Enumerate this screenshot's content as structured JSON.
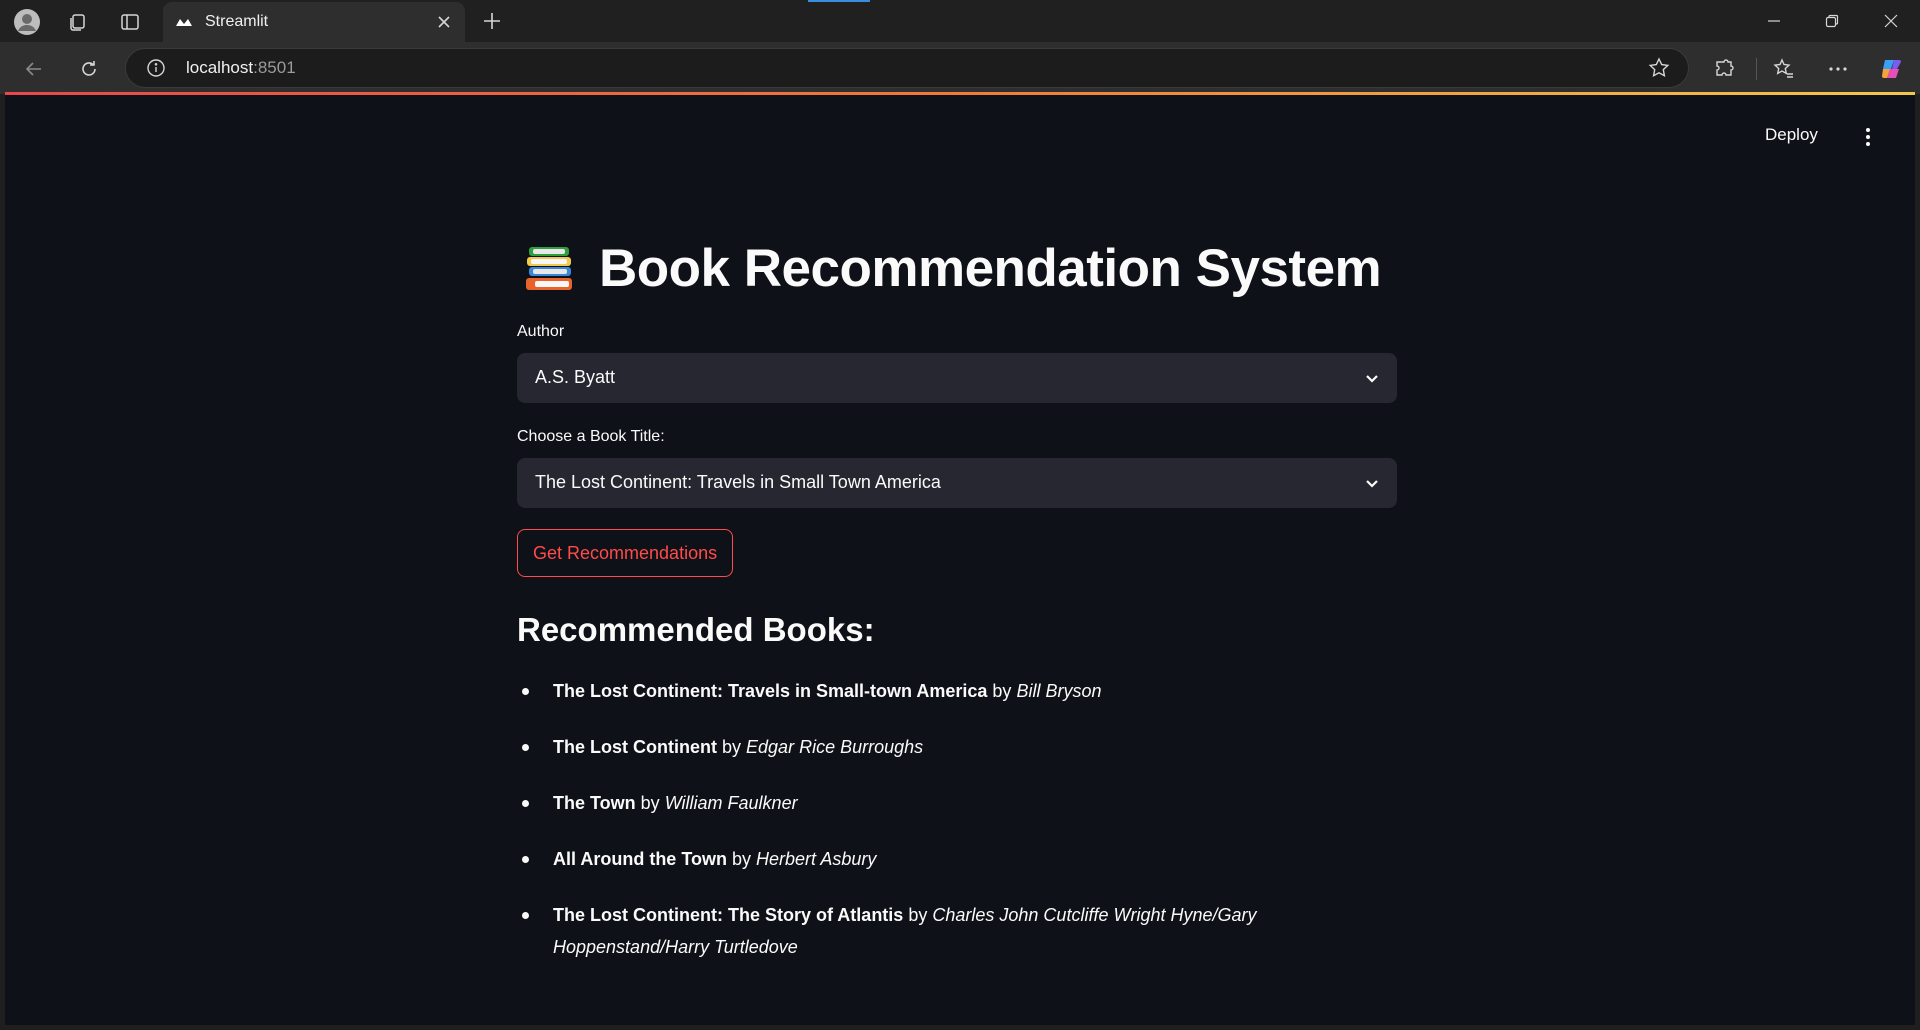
{
  "browser": {
    "tab_title": "Streamlit",
    "url_host": "localhost",
    "url_port": ":8501"
  },
  "app": {
    "deploy_label": "Deploy",
    "title": "Book Recommendation System",
    "title_icon": "books-emoji",
    "author_select": {
      "label": "Author",
      "value": "A.S. Byatt"
    },
    "book_select": {
      "label": "Choose a Book Title:",
      "value": "The Lost Continent: Travels in Small Town America"
    },
    "button_label": "Get Recommendations",
    "recommended_heading": "Recommended Books:",
    "by_word": "by",
    "recommendations": [
      {
        "title": "The Lost Continent: Travels in Small-town America",
        "author": "Bill Bryson"
      },
      {
        "title": "The Lost Continent",
        "author": "Edgar Rice Burroughs"
      },
      {
        "title": "The Town",
        "author": "William Faulkner"
      },
      {
        "title": "All Around the Town",
        "author": "Herbert Asbury"
      },
      {
        "title": "The Lost Continent: The Story of Atlantis",
        "author": "Charles John Cutcliffe Wright Hyne/Gary Hoppenstand/Harry Turtledove"
      }
    ]
  },
  "colors": {
    "app_bg": "#0e1117",
    "select_bg": "#262730",
    "accent": "#ff4b4b",
    "text": "#fafafa"
  }
}
